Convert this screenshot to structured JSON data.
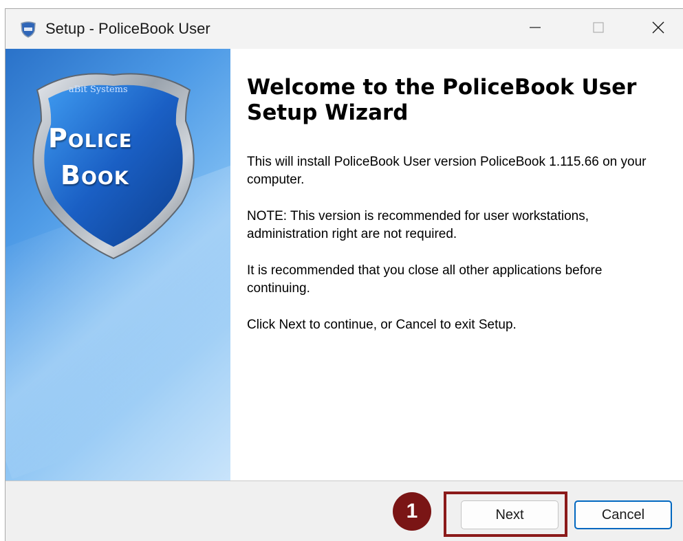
{
  "window": {
    "title": "Setup - PoliceBook User",
    "icon": "policebook-shield-icon"
  },
  "titlebar": {
    "minimize_icon": "minimize-icon",
    "maximize_icon": "maximize-icon",
    "close_icon": "close-icon"
  },
  "sidebar": {
    "logo_small_text": "aBit Systems",
    "logo_line1": "Police",
    "logo_line2": "Book"
  },
  "content": {
    "heading": "Welcome to the PoliceBook User Setup Wizard",
    "paragraphs": [
      "This will install PoliceBook User version PoliceBook 1.115.66 on your computer.",
      "NOTE: This version is recommended for user workstations, administration right are not required.",
      "It is recommended that you close all other applications before continuing.",
      "Click Next to continue, or Cancel to exit Setup."
    ]
  },
  "footer": {
    "next_label": "Next",
    "cancel_label": "Cancel",
    "step_badge": "1"
  },
  "colors": {
    "accent": "#0067c0",
    "highlight": "#8b1a1a",
    "badge": "#7a1515",
    "sidebar_blue": "#2a72c9"
  }
}
